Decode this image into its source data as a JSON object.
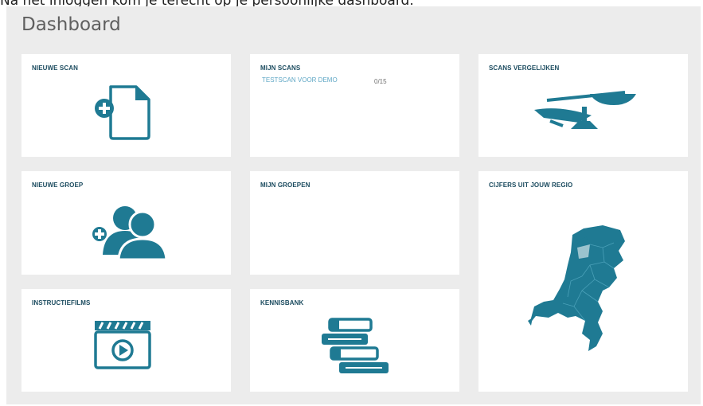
{
  "caption": "Na het inloggen kom je terecht op je persoonlijke dashboard.",
  "dashboard_title": "Dashboard",
  "accent_color": "#1f7a93",
  "cards": {
    "new_scan": {
      "label": "NIEUWE SCAN",
      "icon": "add-document-icon"
    },
    "my_scans": {
      "label": "MIJN SCANS",
      "items": [
        {
          "name": "TESTSCAN VOOR DEMO",
          "count": "0/15"
        }
      ]
    },
    "compare_scans": {
      "label": "SCANS VERGELIJKEN",
      "icon": "balance-scale-icon"
    },
    "new_group": {
      "label": "NIEUWE GROEP",
      "icon": "add-group-icon"
    },
    "my_groups": {
      "label": "MIJN GROEPEN"
    },
    "region_figures": {
      "label": "CIJFERS UIT JOUW REGIO",
      "icon": "netherlands-map-icon"
    },
    "instruction_films": {
      "label": "INSTRUCTIEFILMS",
      "icon": "video-play-icon"
    },
    "knowledge_base": {
      "label": "KENNISBANK",
      "icon": "books-stack-icon"
    }
  }
}
